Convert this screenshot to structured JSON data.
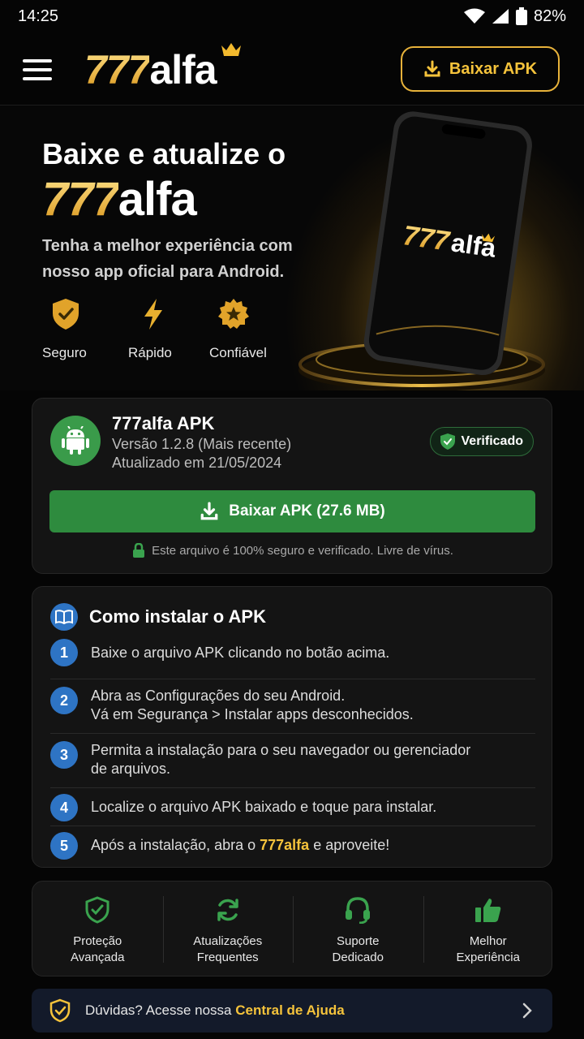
{
  "status": {
    "time": "14:25",
    "battery": "82%"
  },
  "header": {
    "logo_num": "777",
    "logo_word": "alfa",
    "download_button": "Baixar APK"
  },
  "hero": {
    "title": "Baixe e atualize o",
    "brand_num": "777",
    "brand_word": "alfa",
    "subtitle": "Tenha a melhor experiência com nosso app oficial para Android.",
    "features": [
      {
        "label": "Seguro",
        "icon": "shield-check-icon"
      },
      {
        "label": "Rápido",
        "icon": "lightning-icon"
      },
      {
        "label": "Confiável",
        "icon": "star-badge-icon"
      }
    ],
    "phone_logo_num": "777",
    "phone_logo_word": "alfa"
  },
  "app": {
    "name": "777alfa APK",
    "version": "Versão 1.2.8 (Mais recente)",
    "updated": "Atualizado em 21/05/2024",
    "verified": "Verificado",
    "download_button": "Baixar APK (27.6 MB)",
    "safe_note": "Este arquivo é 100% seguro e verificado. Livre de vírus."
  },
  "install": {
    "title": "Como instalar o APK",
    "steps": [
      {
        "num": "1",
        "line1": "Baixe o arquivo APK clicando no botão acima.",
        "line2": ""
      },
      {
        "num": "2",
        "line1": "Abra as Configurações do seu Android.",
        "line2": "Vá em Segurança > Instalar apps desconhecidos."
      },
      {
        "num": "3",
        "line1": "Permita a instalação para o seu navegador ou gerenciador",
        "line2": "de arquivos."
      },
      {
        "num": "4",
        "line1": "Localize o arquivo APK baixado e toque para instalar.",
        "line2": ""
      },
      {
        "num": "5",
        "pre": "Após a instalação, abra o ",
        "highlight": "777alfa",
        "post": " e aproveite!"
      }
    ]
  },
  "benefits": [
    {
      "line1": "Proteção",
      "line2": "Avançada",
      "icon": "shield-check-icon"
    },
    {
      "line1": "Atualizações",
      "line2": "Frequentes",
      "icon": "refresh-icon"
    },
    {
      "line1": "Suporte",
      "line2": "Dedicado",
      "icon": "headset-icon"
    },
    {
      "line1": "Melhor",
      "line2": "Experiência",
      "icon": "thumbs-up-icon"
    }
  ],
  "help": {
    "text": "Dúvidas? Acesse nossa ",
    "link": "Central de Ajuda"
  },
  "colors": {
    "gold": "#f5c33b",
    "green": "#2e8b3e",
    "blue": "#2e74c4",
    "background": "#050505"
  }
}
